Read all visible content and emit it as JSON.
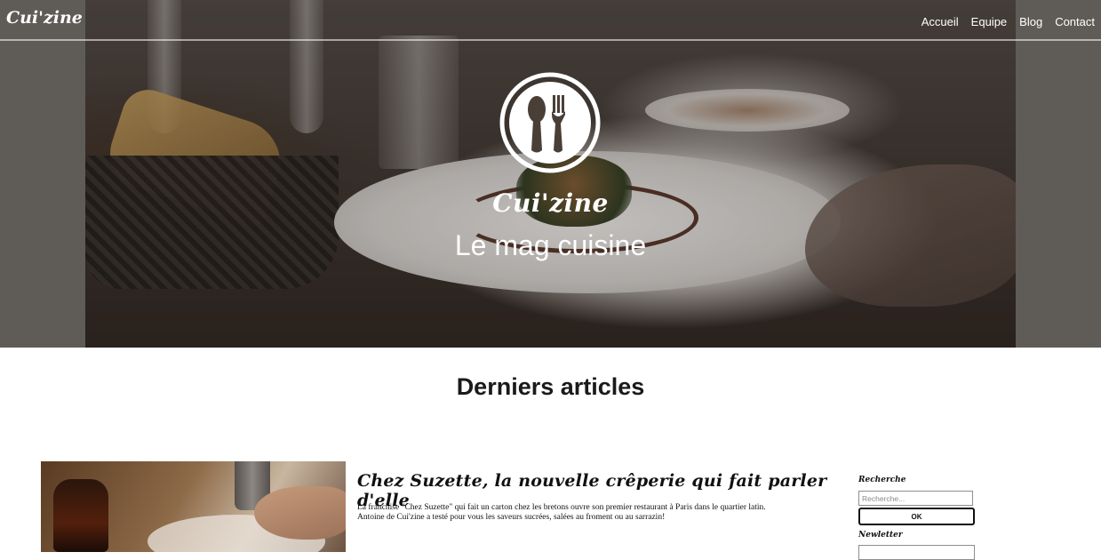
{
  "nav": {
    "brand": "Cui'zine",
    "links": [
      {
        "label": "Accueil"
      },
      {
        "label": "Equipe"
      },
      {
        "label": "Blog"
      },
      {
        "label": "Contact"
      }
    ]
  },
  "hero": {
    "logo_icon": "spoon-fork-icon",
    "title": "Cui'zine",
    "subtitle": "Le mag cuisine"
  },
  "main": {
    "section_title": "Derniers articles",
    "articles": [
      {
        "title": "Chez Suzette, la nouvelle crêperie qui fait parler d'elle",
        "excerpt_line1": "La franchise \"Chez Suzette\" qui fait un carton chez les bretons ouvre son premier restaurant à Paris dans le quartier latin.",
        "excerpt_line2": "Antoine de Cui'zine a testé pour vous les saveurs sucrées, salées au froment ou au sarrazin!"
      }
    ]
  },
  "sidebar": {
    "search_label": "Recherche",
    "search_placeholder": "Recherche...",
    "search_button": "OK",
    "newsletter_label": "Newletter"
  },
  "colors": {
    "hero_overlay": "#5e5954",
    "text": "#111111",
    "white": "#ffffff"
  }
}
